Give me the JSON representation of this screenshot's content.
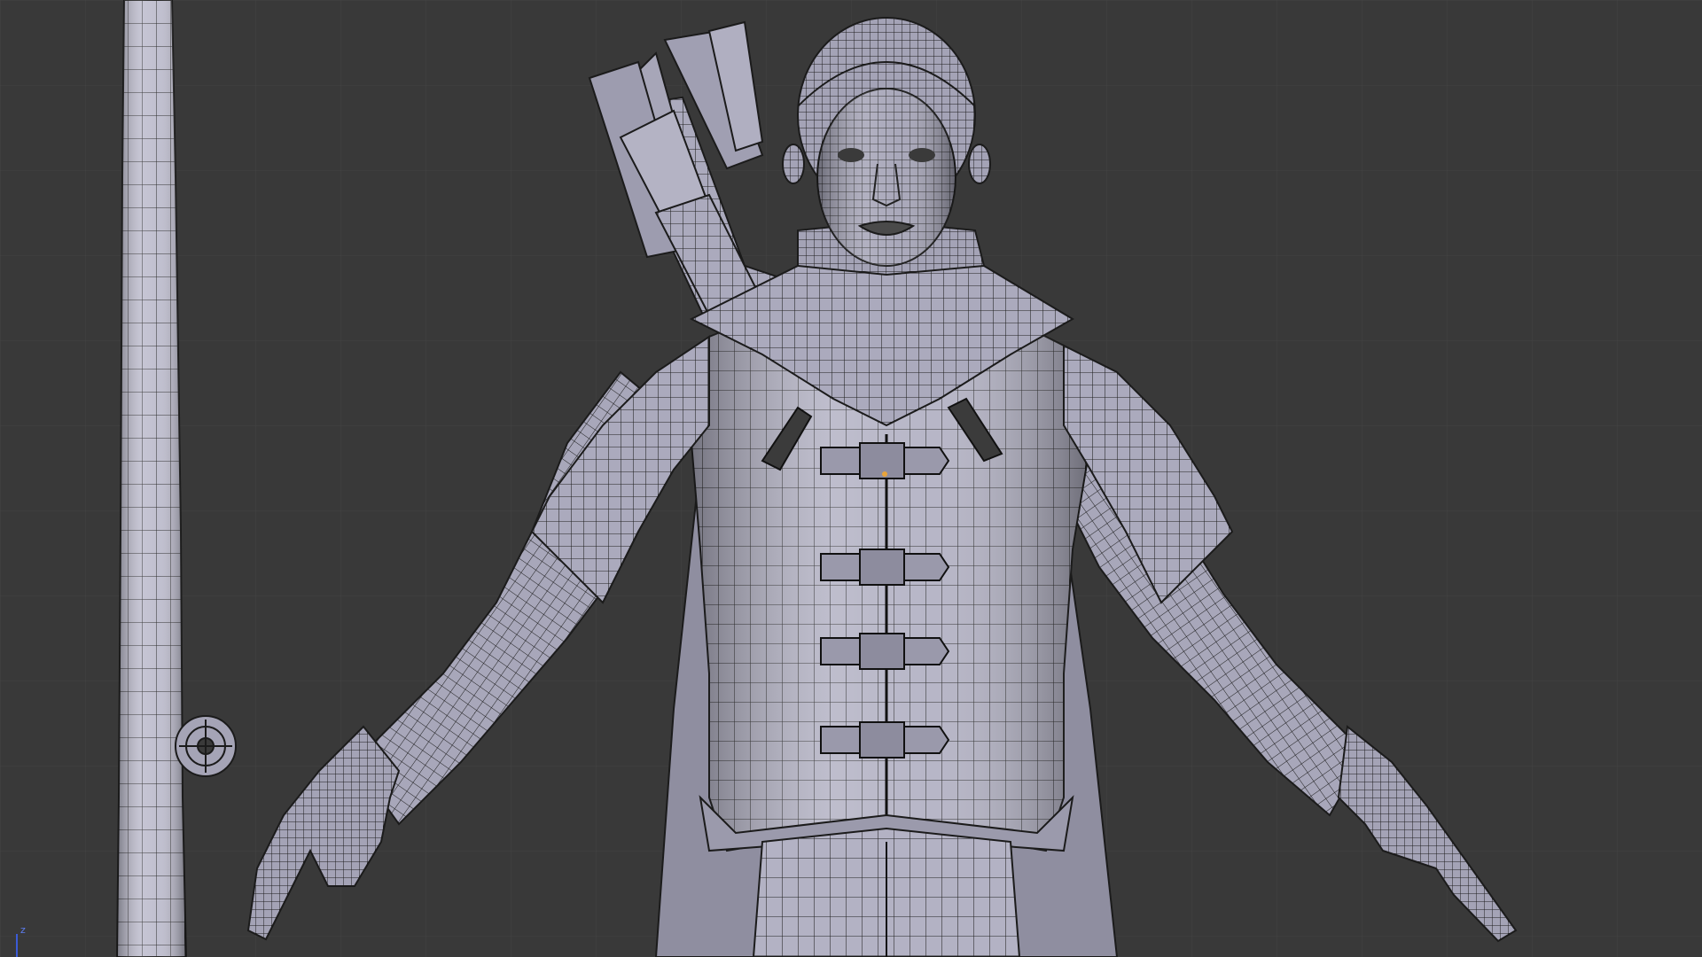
{
  "viewport": {
    "background_color": "#393939",
    "grid_color": "#444444",
    "mesh_fill_color": "#a9a9bc",
    "wire_color": "#1c1c1c",
    "view_mode": "wireframe-on-shaded"
  },
  "axis_gizmo": {
    "axis_label": "z",
    "axis_color": "#3b5bd6"
  },
  "objects": [
    {
      "name": "character-body"
    },
    {
      "name": "quiver-arrows"
    },
    {
      "name": "sword"
    },
    {
      "name": "3d-cursor"
    }
  ]
}
